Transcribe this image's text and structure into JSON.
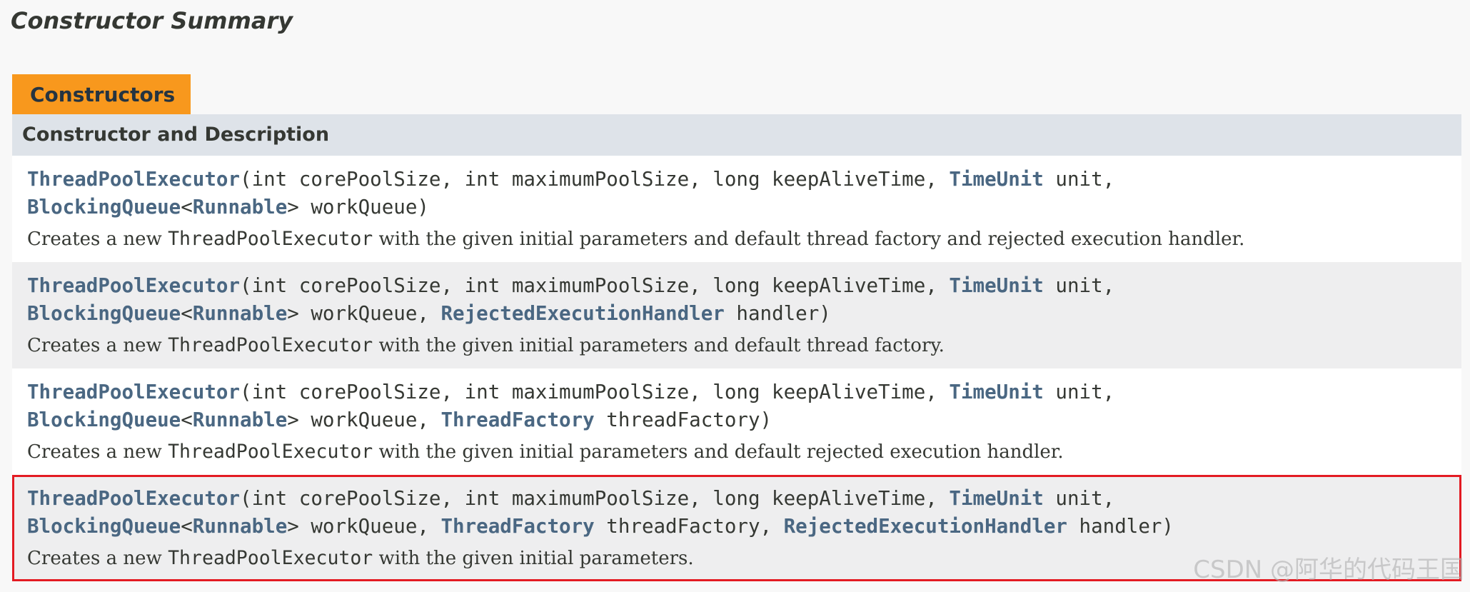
{
  "page_title": "Constructor Summary",
  "caption_tab": "Constructors",
  "table_header": "Constructor and Description",
  "rows": [
    {
      "highlighted": false,
      "line1": {
        "name": "ThreadPoolExecutor",
        "params": "(int corePoolSize, int maximumPoolSize, long keepAliveTime, ",
        "type_timeunit": "TimeUnit",
        "after_timeunit": " unit,"
      },
      "line2": {
        "type_queue": "BlockingQueue",
        "lt": "<",
        "type_runnable": "Runnable",
        "gt_param": "> workQueue)",
        "extra_type_1": "",
        "extra_param_1": "",
        "extra_type_2": "",
        "extra_param_2": ""
      },
      "description": {
        "prefix": "Creates a new ",
        "code": "ThreadPoolExecutor",
        "suffix": " with the given initial parameters and default thread factory and rejected execution handler."
      }
    },
    {
      "highlighted": false,
      "line1": {
        "name": "ThreadPoolExecutor",
        "params": "(int corePoolSize, int maximumPoolSize, long keepAliveTime, ",
        "type_timeunit": "TimeUnit",
        "after_timeunit": " unit,"
      },
      "line2": {
        "type_queue": "BlockingQueue",
        "lt": "<",
        "type_runnable": "Runnable",
        "gt_param": "> workQueue, ",
        "extra_type_1": "RejectedExecutionHandler",
        "extra_param_1": " handler)",
        "extra_type_2": "",
        "extra_param_2": ""
      },
      "description": {
        "prefix": "Creates a new ",
        "code": "ThreadPoolExecutor",
        "suffix": " with the given initial parameters and default thread factory."
      }
    },
    {
      "highlighted": false,
      "line1": {
        "name": "ThreadPoolExecutor",
        "params": "(int corePoolSize, int maximumPoolSize, long keepAliveTime, ",
        "type_timeunit": "TimeUnit",
        "after_timeunit": " unit,"
      },
      "line2": {
        "type_queue": "BlockingQueue",
        "lt": "<",
        "type_runnable": "Runnable",
        "gt_param": "> workQueue, ",
        "extra_type_1": "ThreadFactory",
        "extra_param_1": " threadFactory)",
        "extra_type_2": "",
        "extra_param_2": ""
      },
      "description": {
        "prefix": "Creates a new ",
        "code": "ThreadPoolExecutor",
        "suffix": " with the given initial parameters and default rejected execution handler."
      }
    },
    {
      "highlighted": true,
      "line1": {
        "name": "ThreadPoolExecutor",
        "params": "(int corePoolSize, int maximumPoolSize, long keepAliveTime, ",
        "type_timeunit": "TimeUnit",
        "after_timeunit": " unit,"
      },
      "line2": {
        "type_queue": "BlockingQueue",
        "lt": "<",
        "type_runnable": "Runnable",
        "gt_param": "> workQueue, ",
        "extra_type_1": "ThreadFactory",
        "extra_param_1": " threadFactory, ",
        "extra_type_2": "RejectedExecutionHandler",
        "extra_param_2": " handler)"
      },
      "description": {
        "prefix": "Creates a new ",
        "code": "ThreadPoolExecutor",
        "suffix": " with the given initial parameters."
      }
    }
  ],
  "watermark": "CSDN @阿华的代码王国",
  "colors": {
    "caption_tab_bg": "#f8981d",
    "header_bg": "#dee3e9",
    "link": "#4a6782",
    "highlight_border": "#e31b23"
  }
}
